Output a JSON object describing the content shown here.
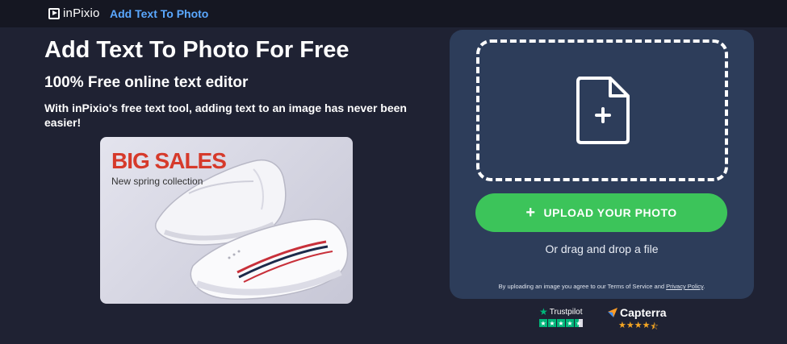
{
  "header": {
    "brand": "inPixio",
    "breadcrumb": "Add Text To Photo"
  },
  "hero": {
    "title": "Add Text To Photo For Free",
    "subtitle": "100% Free online text editor",
    "description": "With inPixio's free text tool, adding text to an image has never been easier!"
  },
  "sample_image": {
    "headline": "BIG SALES",
    "tagline": "New spring collection"
  },
  "upload": {
    "button_label": "UPLOAD YOUR PHOTO",
    "drag_text": "Or drag and drop a file",
    "terms_prefix": "By uploading an image you agree to our Terms of Service and ",
    "privacy_link": "Privacy Policy",
    "terms_suffix": "."
  },
  "ratings": {
    "trustpilot_label": "Trustpilot",
    "trustpilot_stars": 4.5,
    "capterra_label": "Capterra",
    "capterra_stars": 4.5
  },
  "colors": {
    "background": "#1f2233",
    "topbar": "#151722",
    "accent_link": "#5aa8ff",
    "panel": "#2d3d5a",
    "upload_button": "#3cc45a",
    "trustpilot_green": "#00b67a",
    "capterra_orange": "#f5a623",
    "sale_red": "#d63a2b"
  },
  "icons": {
    "logo": "play-square-icon",
    "file": "file-plus-icon",
    "plus": "plus-icon",
    "trustpilot": "star-icon",
    "capterra": "capterra-arrow-icon"
  }
}
